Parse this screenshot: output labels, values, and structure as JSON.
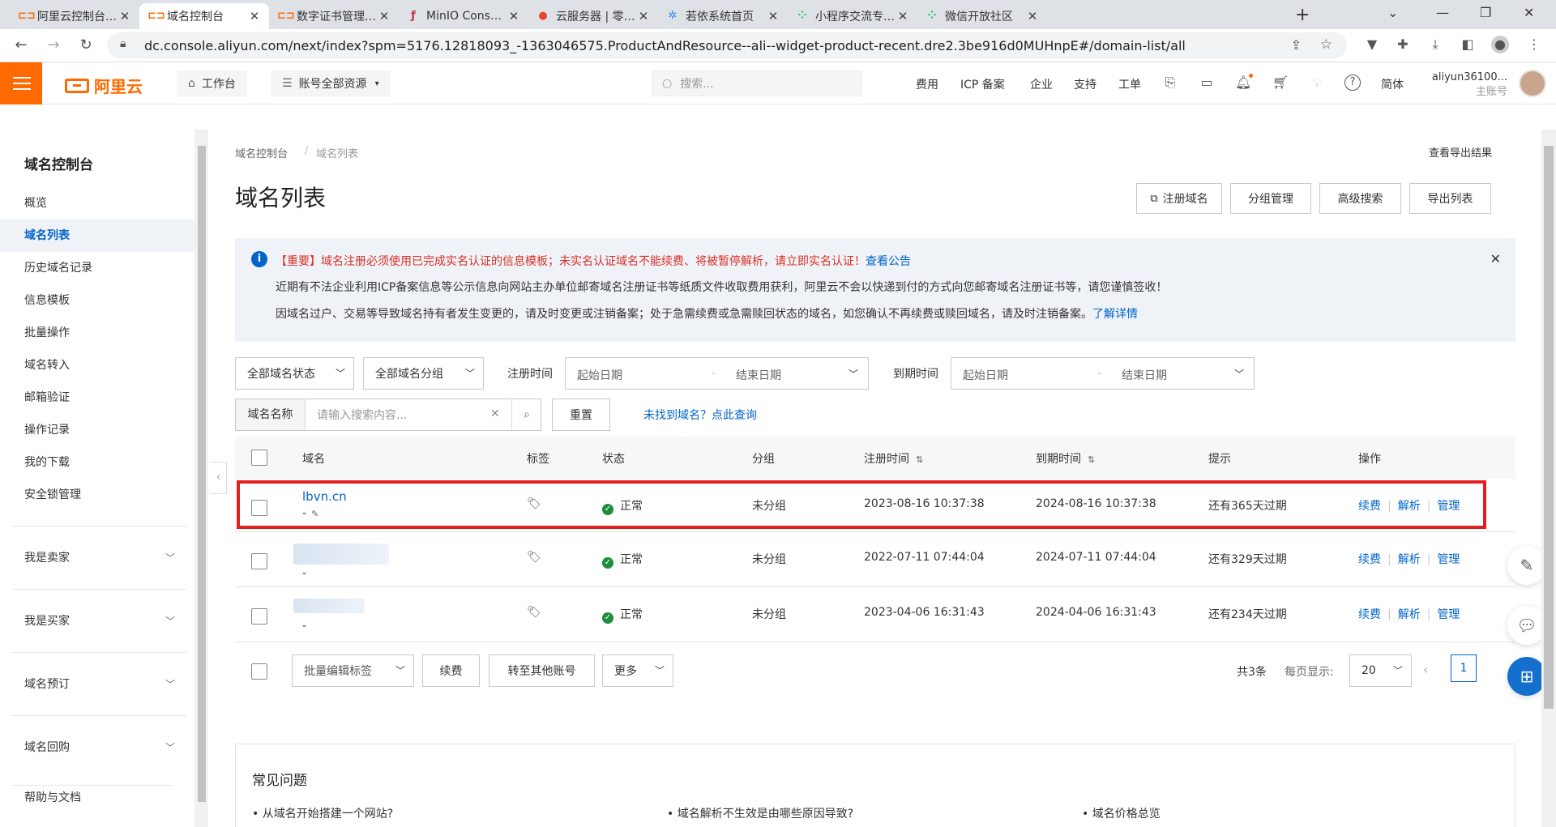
{
  "browser": {
    "tabs": [
      {
        "title": "阿里云控制台首页",
        "icon": "aliyun-icon",
        "active": false
      },
      {
        "title": "域名控制台",
        "icon": "aliyun-icon",
        "active": true
      },
      {
        "title": "数字证书管理服务",
        "icon": "aliyun-icon",
        "active": false
      },
      {
        "title": "MinIO Console",
        "icon": "minio-icon",
        "active": false
      },
      {
        "title": "云服务器 | 零零七",
        "icon": "server-icon",
        "active": false
      },
      {
        "title": "若依系统首页",
        "icon": "ruoyi-icon",
        "active": false
      },
      {
        "title": "小程序交流专区 |",
        "icon": "wechat-icon",
        "active": false
      },
      {
        "title": "微信开放社区",
        "icon": "wechat-icon",
        "active": false
      }
    ],
    "url": "dc.console.aliyun.com/next/index?spm=5176.12818093_-1363046575.ProductAndResource--ali--widget-product-recent.dre2.3be916d0MUHnpE#/domain-list/all"
  },
  "header": {
    "logo": "阿里云",
    "workbench": "工作台",
    "resources": "账号全部资源",
    "search_placeholder": "搜索...",
    "links": [
      "费用",
      "ICP 备案",
      "企业",
      "支持",
      "工单"
    ],
    "lang": "简体",
    "account_name": "aliyun36100...",
    "account_type": "主账号"
  },
  "sidebar": {
    "title": "域名控制台",
    "items": [
      "概览",
      "域名列表",
      "历史域名记录",
      "信息模板",
      "批量操作",
      "域名转入",
      "邮箱验证",
      "操作记录",
      "我的下载",
      "安全锁管理"
    ],
    "active_index": 1,
    "groups": [
      "我是卖家",
      "我是买家",
      "域名预订",
      "域名回购"
    ],
    "footer": "帮助与文档"
  },
  "main": {
    "breadcrumb": [
      "域名控制台",
      "域名列表"
    ],
    "export_results": "查看导出结果",
    "title": "域名列表",
    "actions": [
      "注册域名",
      "分组管理",
      "高级搜索",
      "导出列表"
    ],
    "notice": {
      "important": "【重要】域名注册必须使用已完成实名认证的信息模板；未实名认证域名不能续费、将被暂停解析，请立即实名认证！",
      "important_link": "查看公告",
      "line2": "近期有不法企业利用ICP备案信息等公示信息向网站主办单位邮寄域名注册证书等纸质文件收取费用获利，阿里云不会以快递到付的方式向您邮寄域名注册证书等，请您谨慎签收！",
      "line3": "因域名过户、交易等导致域名持有者发生变更的，请及时变更或注销备案；处于急需续费或急需赎回状态的域名，如您确认不再续费或赎回域名，请及时注销备案。",
      "line3_link": "了解详情"
    },
    "filters": {
      "status": "全部域名状态",
      "group": "全部域名分组",
      "reg_time_label": "注册时间",
      "exp_time_label": "到期时间",
      "start_date": "起始日期",
      "end_date": "结束日期",
      "date_sep": "-",
      "name_label": "域名名称",
      "name_placeholder": "请输入搜索内容...",
      "reset": "重置",
      "not_found": "未找到域名？点此查询"
    },
    "table": {
      "headers": [
        "域名",
        "标签",
        "状态",
        "分组",
        "注册时间",
        "到期时间",
        "提示",
        "操作"
      ],
      "rows": [
        {
          "domain": "lbvn.cn",
          "sub": "-",
          "status": "正常",
          "group": "未分组",
          "reg": "2023-08-16 10:37:38",
          "exp": "2024-08-16 10:37:38",
          "tip": "还有365天过期"
        },
        {
          "domain": "",
          "sub": "-",
          "status": "正常",
          "group": "未分组",
          "reg": "2022-07-11 07:44:04",
          "exp": "2024-07-11 07:44:04",
          "tip": "还有329天过期"
        },
        {
          "domain": "",
          "sub": "-",
          "status": "正常",
          "group": "未分组",
          "reg": "2023-04-06 16:31:43",
          "exp": "2024-04-06 16:31:43",
          "tip": "还有234天过期"
        }
      ],
      "ops": [
        "续费",
        "解析",
        "管理"
      ]
    },
    "bulk": {
      "edit_tags": "批量编辑标签",
      "renew": "续费",
      "transfer": "转至其他账号",
      "more": "更多"
    },
    "pagination": {
      "total": "共3条",
      "per_page_label": "每页显示:",
      "per_page": "20",
      "current": "1"
    },
    "faq": {
      "title": "常见问题",
      "items": [
        "• 从域名开始搭建一个网站?",
        "• 域名解析不生效是由哪些原因导致?",
        "• 域名价格总览"
      ]
    }
  }
}
